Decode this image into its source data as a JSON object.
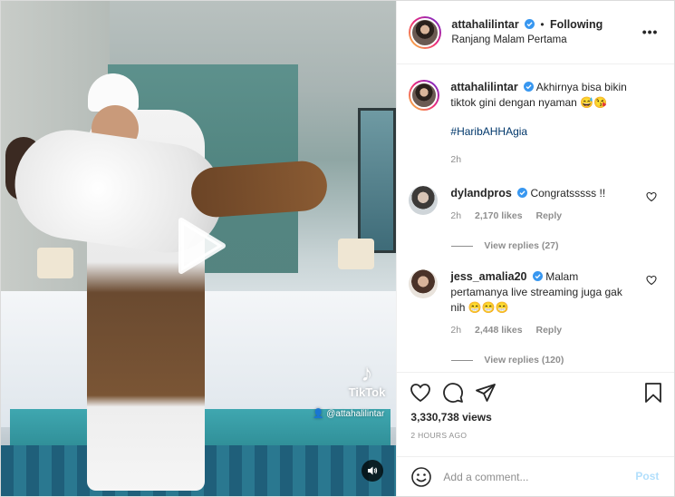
{
  "post": {
    "username": "attahalilintar",
    "follow_status": "Following",
    "location": "Ranjang Malam Pertama"
  },
  "media": {
    "watermark_brand": "TikTok",
    "watermark_handle": "@attahalilintar"
  },
  "caption": {
    "username": "attahalilintar",
    "text": "Akhirnya bisa bikin tiktok gini dengan nyaman 😅😘",
    "hashtag": "#HaribAHHAgia",
    "time": "2h"
  },
  "comments": [
    {
      "username": "dylandpros",
      "text": "Congratsssss !!",
      "time": "2h",
      "likes": "2,170 likes",
      "reply_label": "Reply",
      "view_replies": "View replies (27)"
    },
    {
      "username": "jess_amalia20",
      "text": "Malam pertamanya live streaming juga gak nih 😁😁😁",
      "time": "2h",
      "likes": "2,448 likes",
      "reply_label": "Reply",
      "view_replies": "View replies (120)"
    }
  ],
  "stats": {
    "views": "3,330,738 views",
    "time_ago": "2 HOURS AGO"
  },
  "add_comment": {
    "placeholder": "Add a comment...",
    "post_label": "Post"
  },
  "icons": {
    "more": "more-options-icon",
    "verified": "verified-badge-icon",
    "play": "play-icon",
    "mute": "speaker-icon",
    "like": "heart-icon",
    "comment": "comment-icon",
    "share": "paper-plane-icon",
    "save": "bookmark-icon",
    "emoji": "emoji-icon"
  },
  "colors": {
    "verified": "#3897f0",
    "link": "#00376b",
    "muted": "#8e8e8e",
    "post_disabled": "#b2dffc"
  }
}
